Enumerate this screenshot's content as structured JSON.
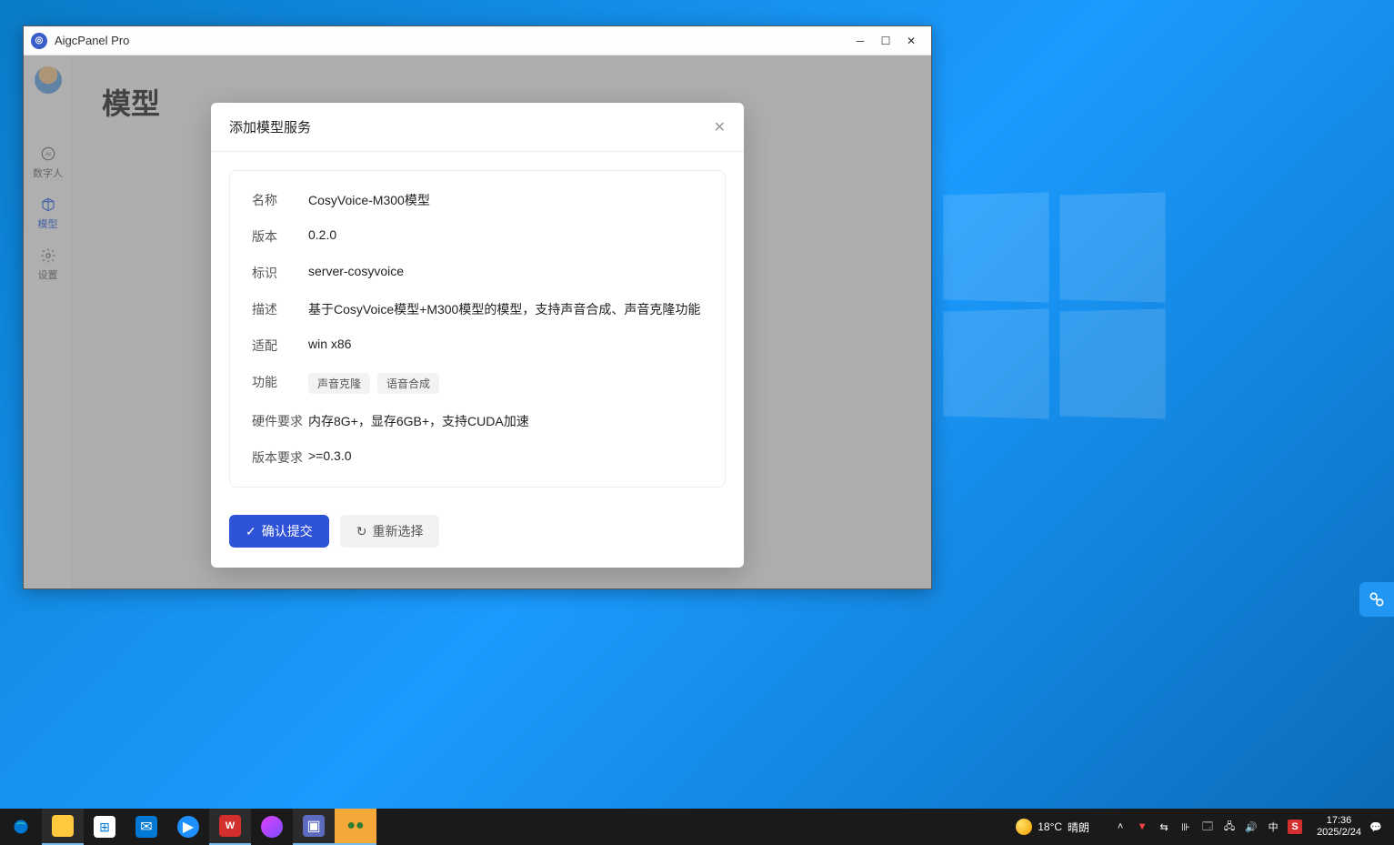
{
  "window": {
    "title": "AigcPanel Pro"
  },
  "sidebar": {
    "nav": [
      {
        "label": "数字人"
      },
      {
        "label": "模型"
      },
      {
        "label": "设置"
      }
    ]
  },
  "page": {
    "heading": "模型"
  },
  "modal": {
    "title": "添加模型服务",
    "rows": {
      "name": {
        "label": "名称",
        "value": "CosyVoice-M300模型"
      },
      "version": {
        "label": "版本",
        "value": "0.2.0"
      },
      "ident": {
        "label": "标识",
        "value": "server-cosyvoice"
      },
      "desc": {
        "label": "描述",
        "value": "基于CosyVoice模型+M300模型的模型，支持声音合成、声音克隆功能"
      },
      "platform": {
        "label": "适配",
        "value": "win x86"
      },
      "feature": {
        "label": "功能",
        "tags": [
          "声音克隆",
          "语音合成"
        ]
      },
      "hardware": {
        "label": "硬件要求",
        "value": "内存8G+，显存6GB+，支持CUDA加速"
      },
      "versionreq": {
        "label": "版本要求",
        "value": ">=0.3.0"
      }
    },
    "confirm": "确认提交",
    "reset": "重新选择"
  },
  "taskbar": {
    "weather": {
      "temp": "18°C",
      "cond": "晴朗"
    },
    "tray": {
      "ime": "中"
    },
    "time": "17:36",
    "date": "2025/2/24"
  }
}
